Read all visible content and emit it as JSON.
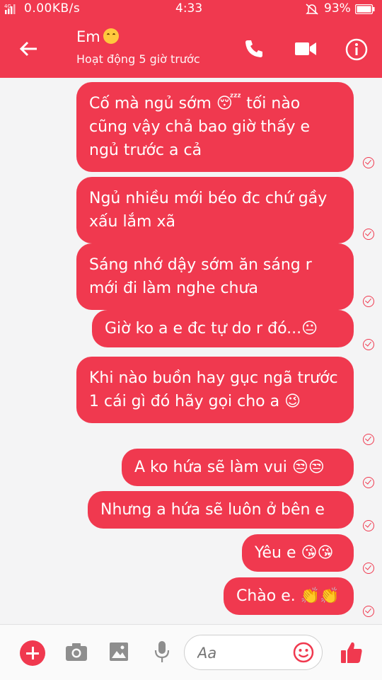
{
  "status_bar": {
    "network_speed": "0.00KB/s",
    "time": "4:33",
    "battery": "93%"
  },
  "header": {
    "contact_name": "Em",
    "contact_status": "Hoạt động 5 giờ trước",
    "icons": [
      "back-arrow-icon",
      "phone-icon",
      "video-camera-icon",
      "info-icon"
    ]
  },
  "messages": [
    {
      "text": "Cố mà ngủ sớm 😴 tối nào cũng vậy chả bao giờ thấy e ngủ trước a cả",
      "status": "seen"
    },
    {
      "text": "Ngủ nhiều mới béo đc chứ gầy xấu lắm xã",
      "status": "seen"
    },
    {
      "text": "Sáng nhớ dậy sớm ăn sáng r mới đi làm nghe chưa",
      "status": "seen"
    },
    {
      "text": "Giờ ko a e đc tự do r đó...😐",
      "status": "seen"
    },
    {
      "text": "Khi nào buồn hay gục ngã trước 1 cái gì đó hãy gọi cho a 😉",
      "status": "seen"
    },
    {
      "text": "A ko hứa sẽ làm vui 😒😒",
      "status": "seen"
    },
    {
      "text": "Nhưng a hứa sẽ luôn ở bên e",
      "status": "seen"
    },
    {
      "text": "Yêu e 😘😘",
      "status": "seen"
    },
    {
      "text": "Chào e. 👏👏",
      "status": "seen"
    }
  ],
  "composer": {
    "placeholder": "Aa",
    "icons": [
      "plus-icon",
      "camera-icon",
      "image-icon",
      "microphone-icon",
      "emoji-icon",
      "thumbs-up-icon"
    ]
  },
  "colors": {
    "accent": "#f0394f",
    "background": "#f4f4f5"
  }
}
